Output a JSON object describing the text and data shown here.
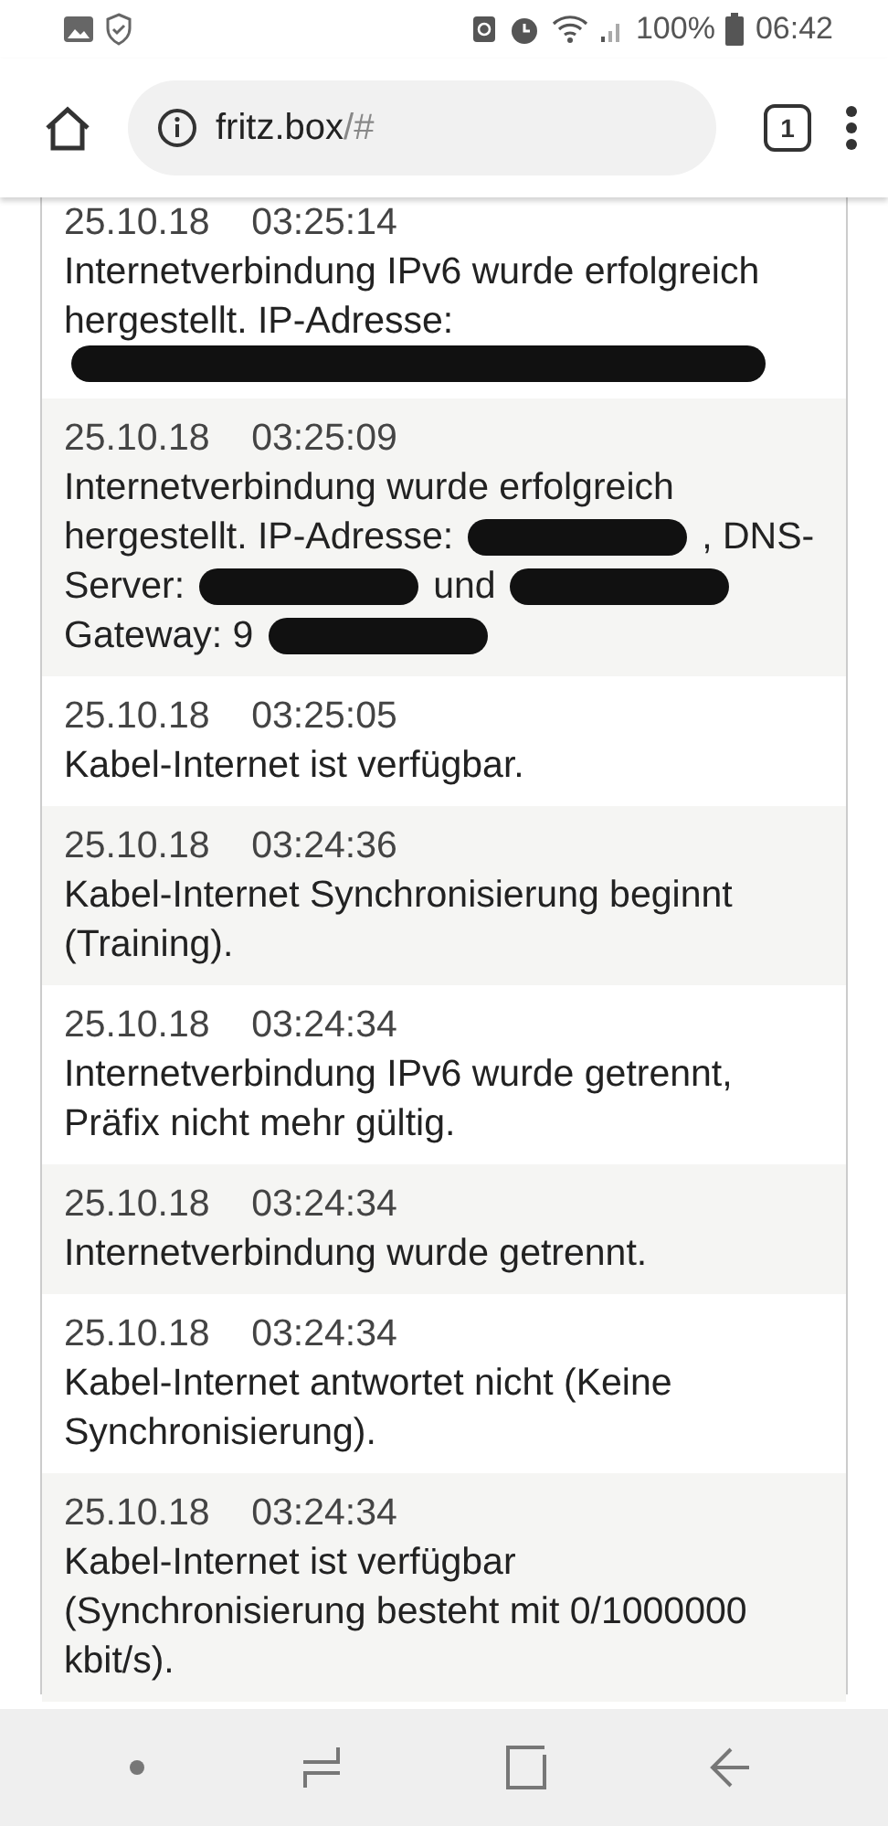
{
  "status_bar": {
    "battery": "100%",
    "time": "06:42"
  },
  "browser": {
    "url_host": "fritz.box",
    "url_path": "/#",
    "tab_count": "1"
  },
  "log_entries": [
    {
      "date": "25.10.18",
      "time": "03:25:14",
      "lines": [
        [
          {
            "kind": "text",
            "text": "Internetverbindung IPv6 wurde erfolgreich hergestellt. IP-Adresse:"
          }
        ],
        [
          {
            "kind": "redacted"
          }
        ]
      ]
    },
    {
      "date": "25.10.18",
      "time": "03:25:09",
      "lines": [
        [
          {
            "kind": "text",
            "text": "Internetverbindung wurde erfolgreich"
          }
        ],
        [
          {
            "kind": "text",
            "text": "hergestellt. IP-Adresse:"
          },
          {
            "kind": "redacted"
          },
          {
            "kind": "text",
            "text": ", DNS-"
          }
        ],
        [
          {
            "kind": "text",
            "text": "Server:"
          },
          {
            "kind": "redacted"
          },
          {
            "kind": "text",
            "text": "und"
          },
          {
            "kind": "redacted"
          }
        ],
        [
          {
            "kind": "text",
            "text": "Gateway: 9"
          },
          {
            "kind": "redacted"
          }
        ]
      ]
    },
    {
      "date": "25.10.18",
      "time": "03:25:05",
      "lines": [
        [
          {
            "kind": "text",
            "text": "Kabel-Internet ist verfügbar."
          }
        ]
      ]
    },
    {
      "date": "25.10.18",
      "time": "03:24:36",
      "lines": [
        [
          {
            "kind": "text",
            "text": "Kabel-Internet Synchronisierung beginnt (Training)."
          }
        ]
      ]
    },
    {
      "date": "25.10.18",
      "time": "03:24:34",
      "lines": [
        [
          {
            "kind": "text",
            "text": "Internetverbindung IPv6 wurde getrennt, Präfix nicht mehr gültig."
          }
        ]
      ]
    },
    {
      "date": "25.10.18",
      "time": "03:24:34",
      "lines": [
        [
          {
            "kind": "text",
            "text": "Internetverbindung wurde getrennt."
          }
        ]
      ]
    },
    {
      "date": "25.10.18",
      "time": "03:24:34",
      "lines": [
        [
          {
            "kind": "text",
            "text": "Kabel-Internet antwortet nicht (Keine Synchronisierung)."
          }
        ]
      ]
    },
    {
      "date": "25.10.18",
      "time": "03:24:34",
      "lines": [
        [
          {
            "kind": "text",
            "text": "Kabel-Internet ist verfügbar (Synchronisierung besteht mit 0/1000000 kbit/s)."
          }
        ]
      ]
    }
  ]
}
